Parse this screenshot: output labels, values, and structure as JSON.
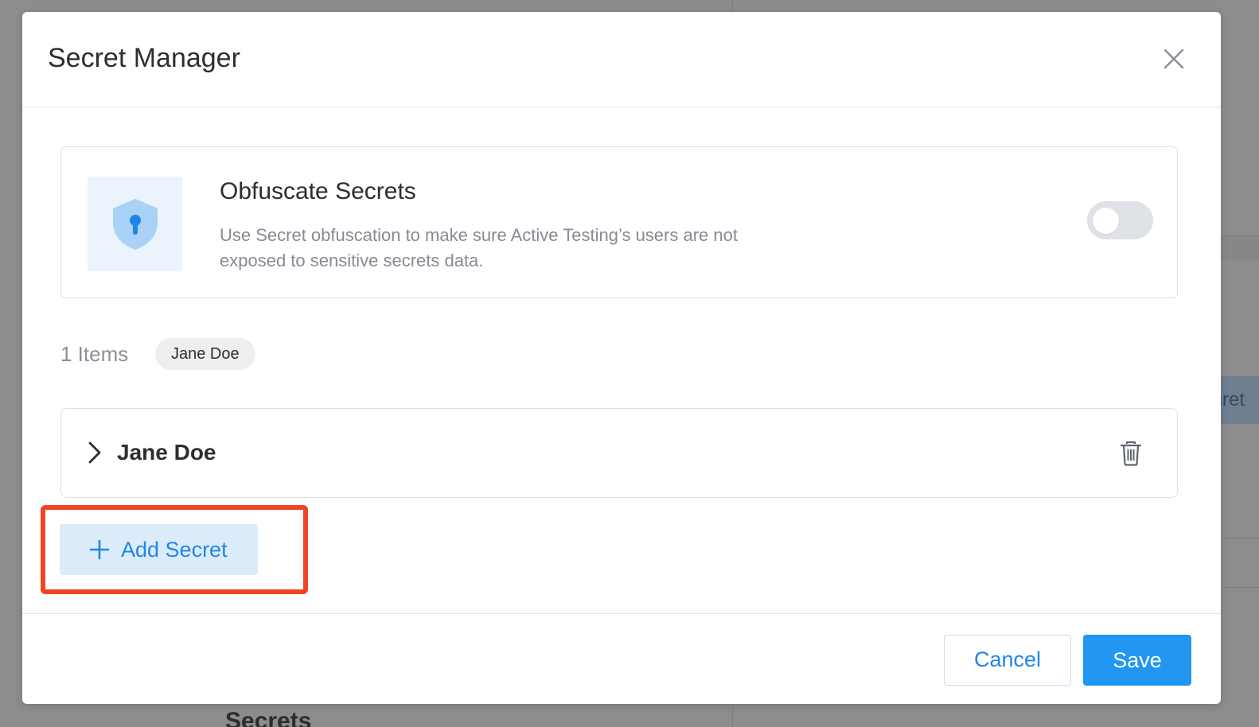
{
  "modal": {
    "title": "Secret Manager"
  },
  "obfuscate": {
    "title": "Obfuscate Secrets",
    "description": "Use Secret obfuscation to make sure Active Testing’s users are not exposed to sensitive secrets data.",
    "enabled": false
  },
  "items": {
    "count_label": "1 Items",
    "filter_chip": "Jane Doe"
  },
  "secrets": [
    {
      "name": "Jane Doe"
    }
  ],
  "actions": {
    "add_secret_label": "Add Secret",
    "cancel_label": "Cancel",
    "save_label": "Save"
  },
  "background": {
    "chip_text": "cret",
    "peek_text": "Secrets"
  },
  "colors": {
    "accent": "#2196f3",
    "highlight": "#f04523",
    "icon_bg": "#ebf3fc"
  }
}
